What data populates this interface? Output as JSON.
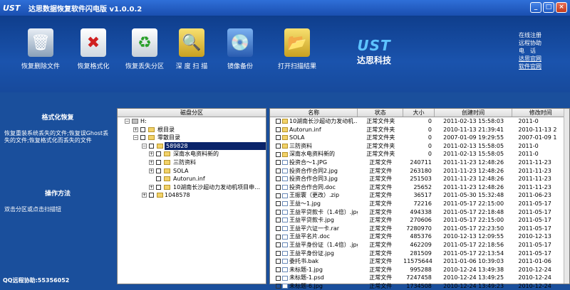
{
  "titlebar": {
    "logo": "UST",
    "title": "达思数据恢复软件闪电版 v1.0.0.2"
  },
  "toolbar": {
    "items": [
      {
        "label": "恢复删除文件",
        "icon": "recycle-bin-icon"
      },
      {
        "label": "恢复格式化",
        "icon": "format-recover-icon"
      },
      {
        "label": "恢复丢失分区",
        "icon": "partition-recover-icon"
      },
      {
        "label": "深 度 扫 描",
        "icon": "deep-scan-icon"
      },
      {
        "label": "镜像备份",
        "icon": "image-backup-icon"
      },
      {
        "label": "打开扫描结果",
        "icon": "open-scan-result-icon"
      }
    ],
    "brand_logo": "UST",
    "brand_name": "达思科技"
  },
  "links": {
    "l1": "在线注册",
    "l2": "远程协助",
    "l3": "电　话",
    "l4": "达思官网",
    "l5": "软件官网"
  },
  "sidebar": {
    "heading1": "格式化恢复",
    "desc1": "恢复重装系统丢失的文件;恢复误Ghost丢失的文件;恢复格式化而丢失的文件",
    "heading2": "操作方法",
    "desc2": "双击分区或点击扫描钮",
    "qq": "QQ远程协助:55356052"
  },
  "tree": {
    "header": "磁盘分区",
    "rows": [
      {
        "text": "H:"
      },
      {
        "text": "根目录"
      },
      {
        "text": "零散目录"
      },
      {
        "text": "589828"
      },
      {
        "text": "深南水电资料新的"
      },
      {
        "text": "三防资料"
      },
      {
        "text": "SOLA"
      },
      {
        "text": "Autorun.inf"
      },
      {
        "text": "10湖南长沙超动力发动机项目申…"
      },
      {
        "text": "1048578"
      }
    ]
  },
  "list": {
    "headers": {
      "name": "名称",
      "status": "状态",
      "size": "大小",
      "created": "创建时间",
      "modified": "修改时间"
    },
    "rows": [
      {
        "name": "10湖南长沙超动力发动机…",
        "status": "正常文件夹",
        "size": "0",
        "created": "2011-02-13 15:58:03",
        "modified": "2011-0"
      },
      {
        "name": "Autorun.inf",
        "status": "正常文件夹",
        "size": "0",
        "created": "2010-11-13 21:39:41",
        "modified": "2010-11-13 2"
      },
      {
        "name": "SOLA",
        "status": "正常文件夹",
        "size": "0",
        "created": "2007-01-09 19:29:55",
        "modified": "2007-01-09 1"
      },
      {
        "name": "三防资料",
        "status": "正常文件夹",
        "size": "0",
        "created": "2011-02-13 15:58:05",
        "modified": "2011-0"
      },
      {
        "name": "深南水电资料新的",
        "status": "正常文件夹",
        "size": "0",
        "created": "2011-02-13 15:58:05",
        "modified": "2011-0"
      },
      {
        "name": "投资合～1.JPG",
        "status": "正常文件",
        "size": "240711",
        "created": "2011-11-23 12:48:26",
        "modified": "2011-11-23"
      },
      {
        "name": "投资合作合同2.jpg",
        "status": "正常文件",
        "size": "263180",
        "created": "2011-11-23 12:48:26",
        "modified": "2011-11-23"
      },
      {
        "name": "投资合作合同3.jpg",
        "status": "正常文件",
        "size": "251503",
        "created": "2011-11-23 12:48:26",
        "modified": "2011-11-23"
      },
      {
        "name": "投资合作合同.doc",
        "status": "正常文件",
        "size": "25652",
        "created": "2011-11-23 12:48:26",
        "modified": "2011-11-23"
      },
      {
        "name": "王振寰（更改）.zip",
        "status": "正常文件",
        "size": "36517",
        "created": "2011-05-30 15:32:48",
        "modified": "2011-06-23"
      },
      {
        "name": "王益～1.jpg",
        "status": "正常文件",
        "size": "72216",
        "created": "2011-05-17 22:15:00",
        "modified": "2011-05-17"
      },
      {
        "name": "王益平贷款卡（1.4倍）.jpg",
        "status": "正常文件",
        "size": "494338",
        "created": "2011-05-17 22:18:48",
        "modified": "2011-05-17"
      },
      {
        "name": "王益平贷款卡.jpg",
        "status": "正常文件",
        "size": "270606",
        "created": "2011-05-17 22:15:00",
        "modified": "2011-05-17"
      },
      {
        "name": "王益平六证一卡.rar",
        "status": "正常文件",
        "size": "7280970",
        "created": "2011-05-17 22:23:50",
        "modified": "2011-05-17"
      },
      {
        "name": "王益平名片.doc",
        "status": "正常文件",
        "size": "485376",
        "created": "2010-12-13 12:09:55",
        "modified": "2010-12-13"
      },
      {
        "name": "王益平身份证（1.4倍）.jpg",
        "status": "正常文件",
        "size": "462209",
        "created": "2011-05-17 22:18:56",
        "modified": "2011-05-17"
      },
      {
        "name": "王益平身份证.jpg",
        "status": "正常文件",
        "size": "281509",
        "created": "2011-05-17 22:13:54",
        "modified": "2011-05-17"
      },
      {
        "name": "委托书.bak",
        "status": "正常文件",
        "size": "11575644",
        "created": "2011-01-06 10:39:03",
        "modified": "2011-01-06"
      },
      {
        "name": "未标题-1.jpg",
        "status": "正常文件",
        "size": "995288",
        "created": "2010-12-24 13:49:38",
        "modified": "2010-12-24"
      },
      {
        "name": "未标题-1.psd",
        "status": "正常文件",
        "size": "7247458",
        "created": "2010-12-24 13:49:25",
        "modified": "2010-12-24"
      },
      {
        "name": "未标题-6.jpg",
        "status": "正常文件",
        "size": "1734508",
        "created": "2010-12-24 13:49:23",
        "modified": "2010-12-24"
      }
    ]
  }
}
